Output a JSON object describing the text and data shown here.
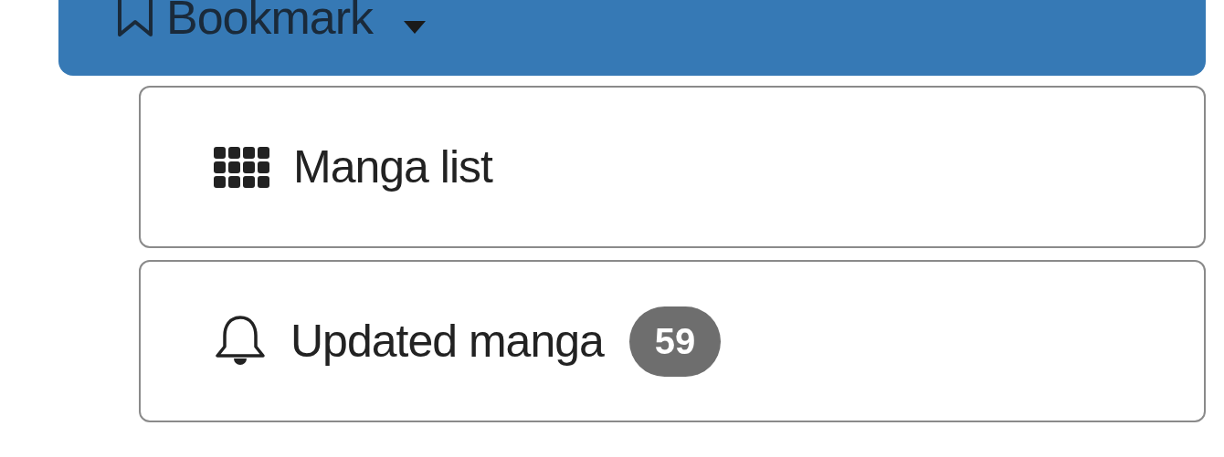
{
  "bookmark_button": {
    "label": "Bookmark",
    "expanded": true
  },
  "menu_items": [
    {
      "kind": "grid",
      "label": "Manga list"
    },
    {
      "kind": "bell",
      "label": "Updated manga",
      "badge": "59"
    }
  ]
}
